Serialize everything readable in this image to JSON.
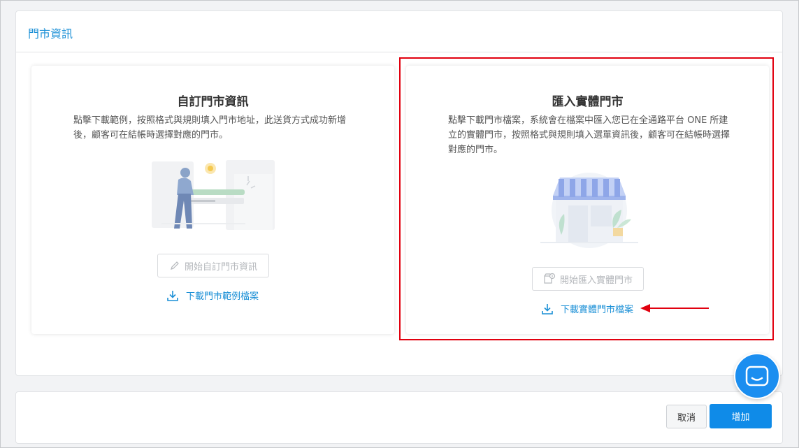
{
  "panel": {
    "title": "門市資訊"
  },
  "cards": {
    "custom": {
      "title": "自訂門市資訊",
      "description": "點擊下載範例，按照格式與規則填入門市地址，此送貨方式成功新增後，顧客可在結帳時選擇對應的門市。",
      "start_button": "開始自訂門市資訊",
      "download_link": "下載門市範例檔案"
    },
    "import": {
      "title": "匯入實體門市",
      "description": "點擊下載門市檔案，系統會在檔案中匯入您已在全通路平台 ONE 所建立的實體門市，按照格式與規則填入選單資訊後，顧客可在結帳時選擇對應的門市。",
      "start_button": "開始匯入實體門市",
      "download_link": "下載實體門市檔案"
    }
  },
  "footer": {
    "cancel_label": "取消",
    "add_label": "增加"
  },
  "colors": {
    "accent": "#1a8fd6",
    "primary_button": "#0f8be8",
    "highlight": "#e1000f"
  }
}
